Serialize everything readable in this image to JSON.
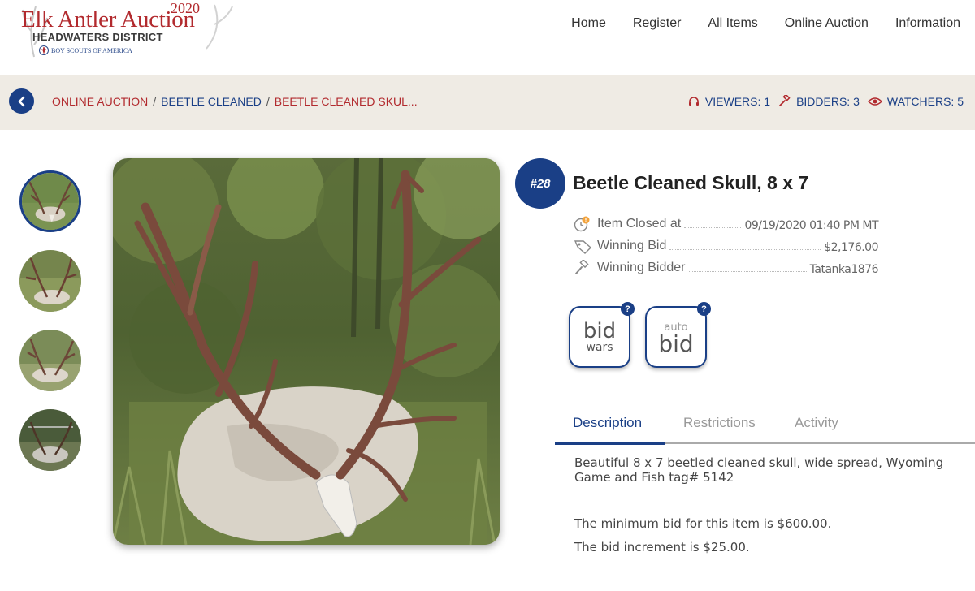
{
  "logo": {
    "year": "2020",
    "title": "Elk Antler Auction",
    "district": "HEADWATERS DISTRICT",
    "org": "BOY SCOUTS OF AMERICA"
  },
  "nav": {
    "items": [
      "Home",
      "Register",
      "All Items",
      "Online Auction",
      "Information"
    ]
  },
  "breadcrumb": {
    "items": [
      "ONLINE AUCTION",
      "BEETLE CLEANED",
      "BEETLE CLEANED SKUL..."
    ],
    "separator": "/"
  },
  "stats": {
    "viewers": "VIEWERS: 1",
    "bidders": "BIDDERS: 3",
    "watchers": "WATCHERS: 5"
  },
  "item": {
    "lot": "#28",
    "title": "Beetle Cleaned Skull, 8 x 7",
    "rows": [
      {
        "label": "Item Closed at",
        "value": "09/19/2020 01:40 PM MT",
        "icon": "clock-alert-icon"
      },
      {
        "label": "Winning Bid",
        "value": "$2,176.00",
        "icon": "price-tag-icon"
      },
      {
        "label": "Winning Bidder",
        "value": "Tatanka1876",
        "icon": "gavel-icon"
      }
    ]
  },
  "bid_widgets": {
    "bidwars": {
      "line1": "bid",
      "line2": "wars"
    },
    "autobid": {
      "line1": "auto",
      "line2": "bid"
    },
    "help": "?"
  },
  "tabs": [
    "Description",
    "Restrictions",
    "Activity"
  ],
  "description": {
    "text": "Beautiful 8 x 7 beetled cleaned skull, wide spread, Wyoming Game and Fish tag# 5142",
    "min_bid": "The minimum bid for this item is $600.00.",
    "increment": "The bid increment is $25.00."
  },
  "colors": {
    "brand_blue": "#1a3f86",
    "brand_red": "#b22a2e",
    "crumb_bg": "#efebe4"
  }
}
